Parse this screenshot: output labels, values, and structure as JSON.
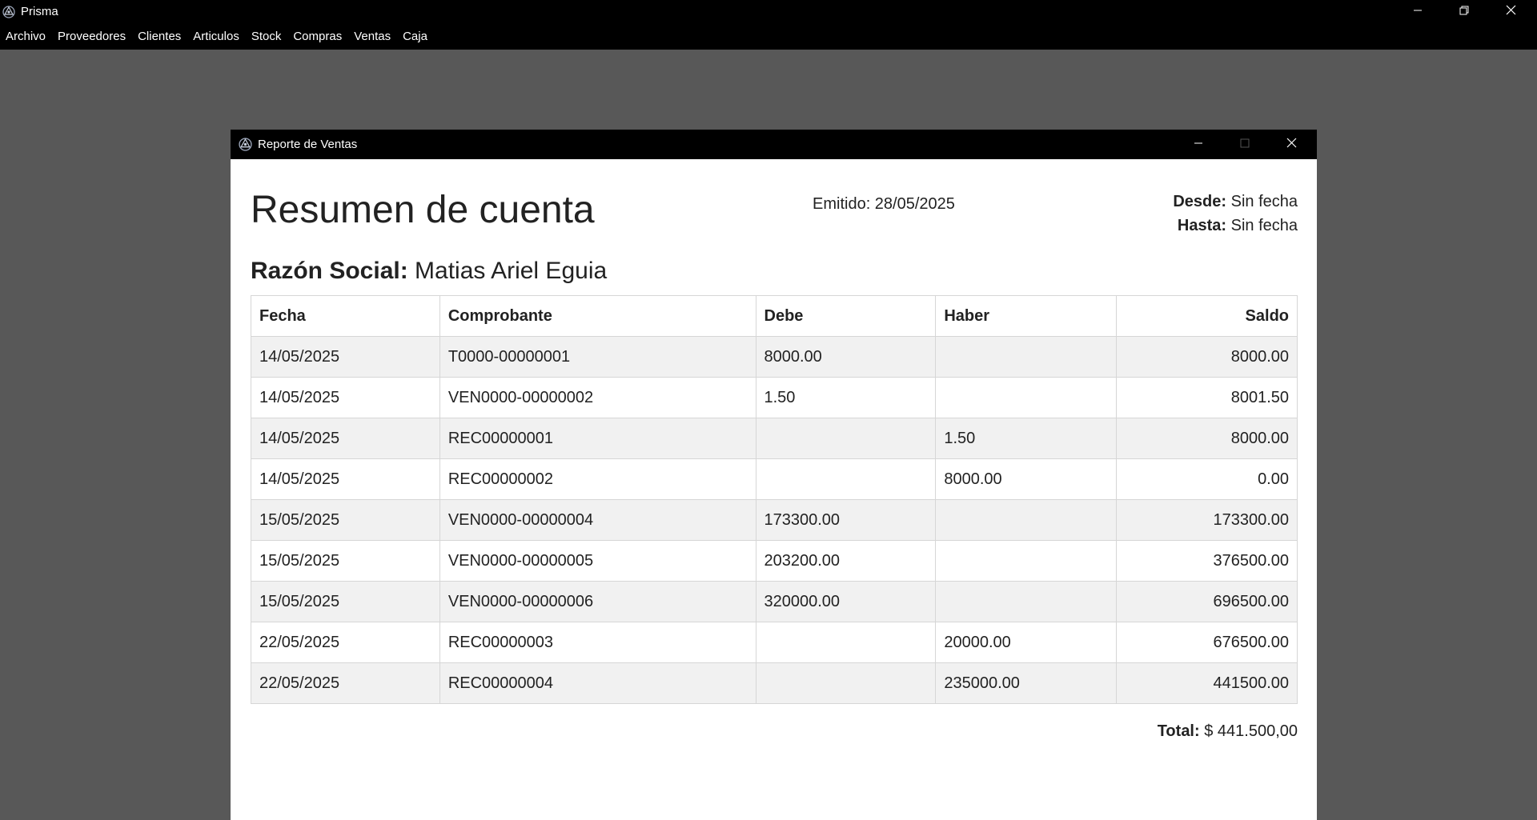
{
  "app": {
    "title": "Prisma",
    "menu": [
      "Archivo",
      "Proveedores",
      "Clientes",
      "Articulos",
      "Stock",
      "Compras",
      "Ventas",
      "Caja"
    ]
  },
  "child_window": {
    "title": "Reporte de Ventas"
  },
  "report": {
    "title": "Resumen de cuenta",
    "emitido": "Emitido: 28/05/2025",
    "desde_label": "Desde:",
    "desde_value": "Sin fecha",
    "hasta_label": "Hasta:",
    "hasta_value": "Sin fecha",
    "razon_label": "Razón Social:",
    "razon_value": "Matias Ariel Eguia",
    "columns": [
      "Fecha",
      "Comprobante",
      "Debe",
      "Haber",
      "Saldo"
    ],
    "rows": [
      [
        "14/05/2025",
        "T0000-00000001",
        "8000.00",
        "",
        "8000.00"
      ],
      [
        "14/05/2025",
        "VEN0000-00000002",
        "1.50",
        "",
        "8001.50"
      ],
      [
        "14/05/2025",
        "REC00000001",
        "",
        "1.50",
        "8000.00"
      ],
      [
        "14/05/2025",
        "REC00000002",
        "",
        "8000.00",
        "0.00"
      ],
      [
        "15/05/2025",
        "VEN0000-00000004",
        "173300.00",
        "",
        "173300.00"
      ],
      [
        "15/05/2025",
        "VEN0000-00000005",
        "203200.00",
        "",
        "376500.00"
      ],
      [
        "15/05/2025",
        "VEN0000-00000006",
        "320000.00",
        "",
        "696500.00"
      ],
      [
        "22/05/2025",
        "REC00000003",
        "",
        "20000.00",
        "676500.00"
      ],
      [
        "22/05/2025",
        "REC00000004",
        "",
        "235000.00",
        "441500.00"
      ]
    ],
    "total_label": "Total:",
    "total_value": "$ 441.500,00"
  },
  "icons": {
    "app_logo": "prisma-logo-icon",
    "minimize": "minimize-icon",
    "maximize": "maximize-icon",
    "restore": "restore-icon",
    "close": "close-icon"
  }
}
